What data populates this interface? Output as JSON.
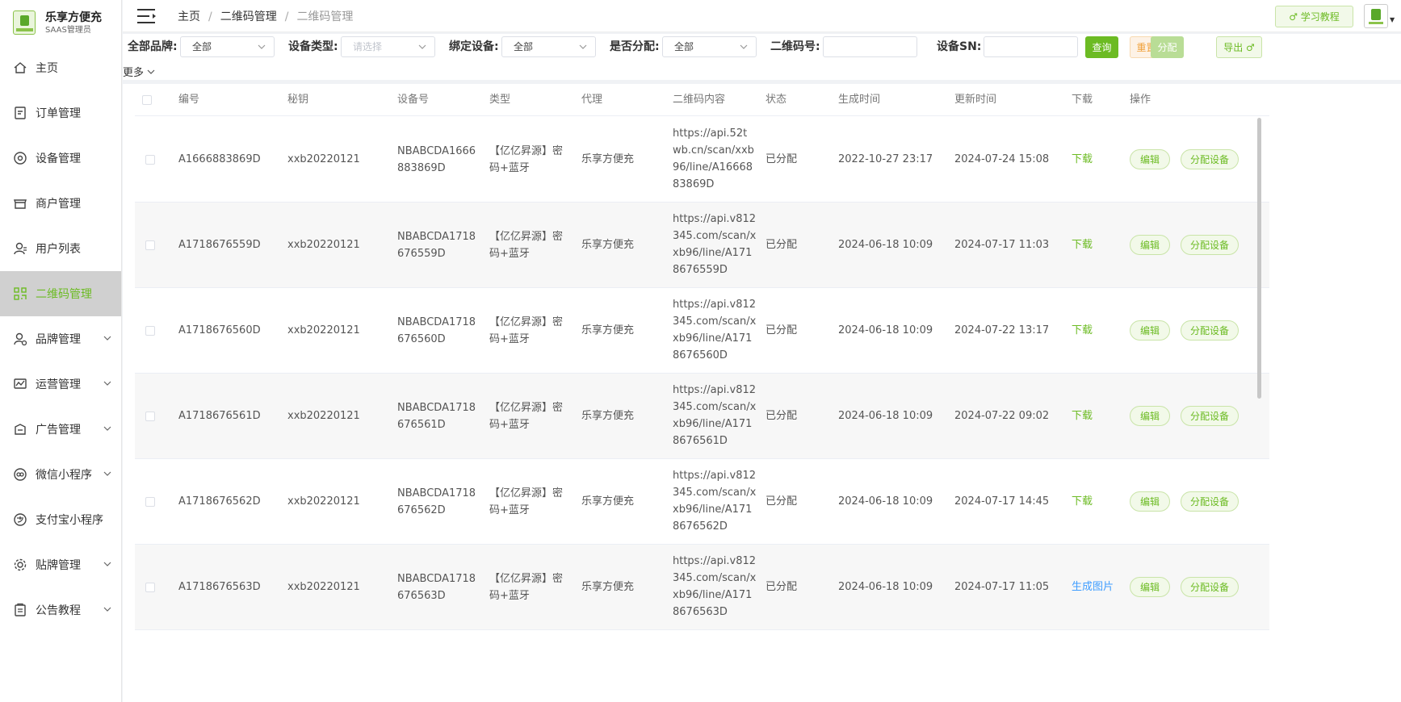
{
  "sidebar": {
    "app_name": "乐享方便充",
    "role": "SAAS管理员",
    "items": [
      {
        "label": "主页",
        "icon": "home-icon",
        "expandable": false,
        "active": false
      },
      {
        "label": "订单管理",
        "icon": "order-icon",
        "expandable": false,
        "active": false
      },
      {
        "label": "设备管理",
        "icon": "device-icon",
        "expandable": false,
        "active": false
      },
      {
        "label": "商户管理",
        "icon": "store-icon",
        "expandable": false,
        "active": false
      },
      {
        "label": "用户列表",
        "icon": "user-icon",
        "expandable": false,
        "active": false
      },
      {
        "label": "二维码管理",
        "icon": "qrcode-icon",
        "expandable": false,
        "active": true
      },
      {
        "label": "品牌管理",
        "icon": "brand-icon",
        "expandable": true,
        "active": false
      },
      {
        "label": "运营管理",
        "icon": "operation-chart-icon",
        "expandable": true,
        "active": false
      },
      {
        "label": "广告管理",
        "icon": "ad-icon",
        "expandable": true,
        "active": false
      },
      {
        "label": "微信小程序",
        "icon": "wechat-icon",
        "expandable": true,
        "active": false
      },
      {
        "label": "支付宝小程序",
        "icon": "alipay-icon",
        "expandable": false,
        "active": false
      },
      {
        "label": "贴牌管理",
        "icon": "gear-icon",
        "expandable": true,
        "active": false
      },
      {
        "label": "公告教程",
        "icon": "notice-icon",
        "expandable": true,
        "active": false
      }
    ]
  },
  "header": {
    "breadcrumb": [
      "主页",
      "二维码管理",
      "二维码管理"
    ],
    "tutorial_label": "♂ 学习教程"
  },
  "filter": {
    "brand_label": "全部品牌:",
    "brand_value": "全部",
    "type_label": "设备类型:",
    "type_placeholder": "请选择",
    "bind_label": "绑定设备:",
    "bind_value": "全部",
    "assigned_label": "是否分配:",
    "assigned_value": "全部",
    "qrcode_label": "二维码号:",
    "qrcode_value": "",
    "sn_label": "设备SN:",
    "sn_value": "",
    "query_label": "查询",
    "reset_label": "重置",
    "assign_label": "分配",
    "export_label": "导出 ♂",
    "more_label": "更多"
  },
  "table": {
    "columns": [
      "编号",
      "秘钥",
      "设备号",
      "类型",
      "代理",
      "二维码内容",
      "状态",
      "生成时间",
      "更新时间",
      "下载",
      "操作"
    ],
    "edit_label": "编辑",
    "assign_device_label": "分配设备",
    "rows": [
      {
        "id": "A1666883869D",
        "secret": "xxb20220121",
        "device": [
          "NBABCDA1666",
          "883869D"
        ],
        "type": [
          "【亿亿昇源】密",
          "码+蓝牙"
        ],
        "agent": "乐享方便充",
        "content": [
          "https://api.52t",
          "wb.cn/scan/xxb",
          "96/line/A16668",
          "83869D"
        ],
        "status": "已分配",
        "created": "2022-10-27 23:17",
        "updated": "2024-07-24 15:08",
        "download": "下载"
      },
      {
        "id": "A1718676559D",
        "secret": "xxb20220121",
        "device": [
          "NBABCDA1718",
          "676559D"
        ],
        "type": [
          "【亿亿昇源】密",
          "码+蓝牙"
        ],
        "agent": "乐享方便充",
        "content": [
          "https://api.v812",
          "345.com/scan/x",
          "xb96/line/A171",
          "8676559D"
        ],
        "status": "已分配",
        "created": "2024-06-18 10:09",
        "updated": "2024-07-17 11:03",
        "download": "下载"
      },
      {
        "id": "A1718676560D",
        "secret": "xxb20220121",
        "device": [
          "NBABCDA1718",
          "676560D"
        ],
        "type": [
          "【亿亿昇源】密",
          "码+蓝牙"
        ],
        "agent": "乐享方便充",
        "content": [
          "https://api.v812",
          "345.com/scan/x",
          "xb96/line/A171",
          "8676560D"
        ],
        "status": "已分配",
        "created": "2024-06-18 10:09",
        "updated": "2024-07-22 13:17",
        "download": "下载"
      },
      {
        "id": "A1718676561D",
        "secret": "xxb20220121",
        "device": [
          "NBABCDA1718",
          "676561D"
        ],
        "type": [
          "【亿亿昇源】密",
          "码+蓝牙"
        ],
        "agent": "乐享方便充",
        "content": [
          "https://api.v812",
          "345.com/scan/x",
          "xb96/line/A171",
          "8676561D"
        ],
        "status": "已分配",
        "created": "2024-06-18 10:09",
        "updated": "2024-07-22 09:02",
        "download": "下载"
      },
      {
        "id": "A1718676562D",
        "secret": "xxb20220121",
        "device": [
          "NBABCDA1718",
          "676562D"
        ],
        "type": [
          "【亿亿昇源】密",
          "码+蓝牙"
        ],
        "agent": "乐享方便充",
        "content": [
          "https://api.v812",
          "345.com/scan/x",
          "xb96/line/A171",
          "8676562D"
        ],
        "status": "已分配",
        "created": "2024-06-18 10:09",
        "updated": "2024-07-17 14:45",
        "download": "下载"
      },
      {
        "id": "A1718676563D",
        "secret": "xxb20220121",
        "device": [
          "NBABCDA1718",
          "676563D"
        ],
        "type": [
          "【亿亿昇源】密",
          "码+蓝牙"
        ],
        "agent": "乐享方便充",
        "content": [
          "https://api.v812",
          "345.com/scan/x",
          "xb96/line/A171",
          "8676563D"
        ],
        "status": "已分配",
        "created": "2024-06-18 10:09",
        "updated": "2024-07-17 11:05",
        "download": "生成图片"
      }
    ]
  },
  "colors": {
    "accent": "#6cbb23",
    "link_blue": "#409eff",
    "warning": "#f0a23c"
  }
}
